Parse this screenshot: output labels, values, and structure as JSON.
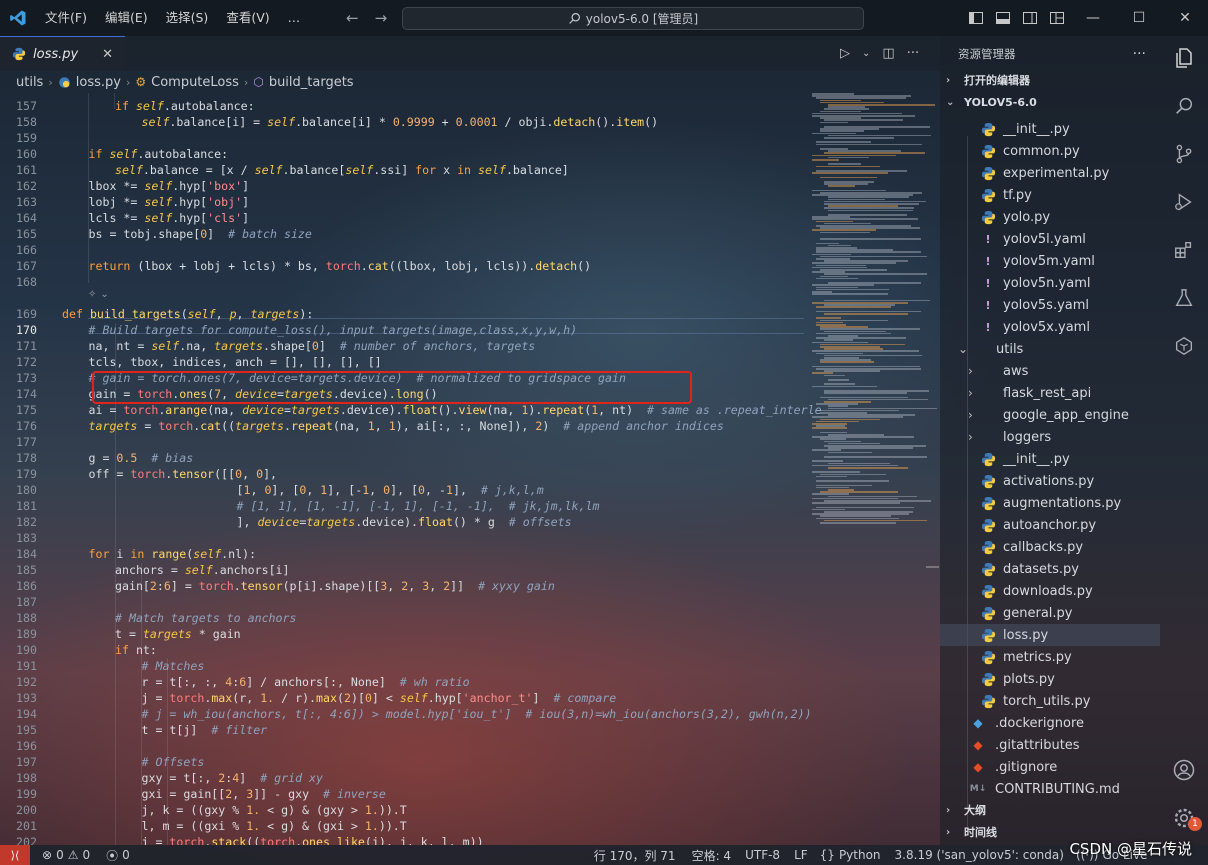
{
  "titlebar": {
    "menu": [
      "文件(F)",
      "编辑(E)",
      "选择(S)",
      "查看(V)",
      "…"
    ],
    "search": "yolov5-6.0 [管理员]"
  },
  "tab": {
    "name": "loss.py",
    "close": "✕"
  },
  "breadcrumb": {
    "folder": "utils",
    "file": "loss.py",
    "class": "ComputeLoss",
    "method": "build_targets"
  },
  "editor": {
    "active_line": 170,
    "lines": [
      {
        "n": "157",
        "indent": 2,
        "html": "<span class='kw'>if</span> <span class='self'>self</span>.autobalance:"
      },
      {
        "n": "158",
        "indent": 3,
        "html": "<span class='self'>self</span>.balance[i] = <span class='self'>self</span>.balance[i] * <span class='num'>0.9999</span> + <span class='num'>0.0001</span> / obji.<span class='fn'>detach</span>().<span class='fn'>item</span>()"
      },
      {
        "n": "159",
        "indent": 0,
        "html": ""
      },
      {
        "n": "160",
        "indent": 1,
        "html": "<span class='kw'>if</span> <span class='self'>self</span>.autobalance:"
      },
      {
        "n": "161",
        "indent": 2,
        "html": "<span class='self'>self</span>.balance = [x / <span class='self'>self</span>.balance[<span class='self'>self</span>.ssi] <span class='kw'>for</span> x <span class='kw'>in</span> <span class='self'>self</span>.balance]"
      },
      {
        "n": "162",
        "indent": 1,
        "html": "lbox *= <span class='self'>self</span>.hyp[<span class='str'>'box'</span>]"
      },
      {
        "n": "163",
        "indent": 1,
        "html": "lobj *= <span class='self'>self</span>.hyp[<span class='str'>'obj'</span>]"
      },
      {
        "n": "164",
        "indent": 1,
        "html": "lcls *= <span class='self'>self</span>.hyp[<span class='str'>'cls'</span>]"
      },
      {
        "n": "165",
        "indent": 1,
        "html": "bs = tobj.shape[<span class='num'>0</span>]  <span class='cm'># batch size</span>"
      },
      {
        "n": "166",
        "indent": 0,
        "html": ""
      },
      {
        "n": "167",
        "indent": 1,
        "html": "<span class='kw'>return</span> (lbox + lobj + lcls) * bs, <span class='mod'>torch</span>.<span class='fn'>cat</span>((lbox, lobj, lcls)).<span class='fn'>detach</span>()"
      },
      {
        "n": "168",
        "indent": 0,
        "html": ""
      },
      {
        "n": "",
        "indent": 0,
        "html": ""
      },
      {
        "n": "169",
        "indent": 0,
        "html": "<span class='kw'>def</span> <span class='fn'>build_targets</span>(<span class='param'>self</span>, <span class='param'>p</span>, <span class='param'>targets</span>):"
      },
      {
        "n": "170",
        "indent": 1,
        "html": "<span class='cm'># Build targets for compute_loss(), input targets(image,class,x,y,w,h)</span>"
      },
      {
        "n": "171",
        "indent": 1,
        "html": "na, nt = <span class='self'>self</span>.na, <span class='param'>targets</span>.shape[<span class='num'>0</span>]  <span class='cm'># number of anchors, targets</span>"
      },
      {
        "n": "172",
        "indent": 1,
        "html": "tcls, tbox, indices, anch = [], [], [], []"
      },
      {
        "n": "173",
        "indent": 1,
        "html": "<span class='cm'># gain = torch.ones(7, device=targets.device)  # normalized to gridspace gain</span>"
      },
      {
        "n": "174",
        "indent": 1,
        "html": "gain = <span class='mod'>torch</span>.<span class='fn'>ones</span>(<span class='num'>7</span>, <span class='kwarg'>device</span>=<span class='param'>targets</span>.device).<span class='fn'>long</span>()"
      },
      {
        "n": "175",
        "indent": 1,
        "html": "ai = <span class='mod'>torch</span>.<span class='fn'>arange</span>(na, <span class='kwarg'>device</span>=<span class='param'>targets</span>.device).<span class='fn'>float</span>().<span class='fn'>view</span>(na, <span class='num'>1</span>).<span class='fn'>repeat</span>(<span class='num'>1</span>, nt)  <span class='cm'># same as .repeat_interle</span>"
      },
      {
        "n": "176",
        "indent": 1,
        "html": "<span class='param'>targets</span> = <span class='mod'>torch</span>.<span class='fn'>cat</span>((<span class='param'>targets</span>.<span class='fn'>repeat</span>(na, <span class='num'>1</span>, <span class='num'>1</span>), ai[:, :, None]), <span class='num'>2</span>)  <span class='cm'># append anchor indices</span>"
      },
      {
        "n": "177",
        "indent": 0,
        "html": ""
      },
      {
        "n": "178",
        "indent": 1,
        "html": "g = <span class='num'>0.5</span>  <span class='cm'># bias</span>"
      },
      {
        "n": "179",
        "indent": 1,
        "html": "off = <span class='mod'>torch</span>.<span class='fn'>tensor</span>([[<span class='num'>0</span>, <span class='num'>0</span>],"
      },
      {
        "n": "180",
        "indent": 0,
        "html": "                         [<span class='num'>1</span>, <span class='num'>0</span>], [<span class='num'>0</span>, <span class='num'>1</span>], [-<span class='num'>1</span>, <span class='num'>0</span>], [<span class='num'>0</span>, -<span class='num'>1</span>],  <span class='cm'># j,k,l,m</span>"
      },
      {
        "n": "181",
        "indent": 0,
        "html": "                         <span class='cm'># [1, 1], [1, -1], [-1, 1], [-1, -1],  # jk,jm,lk,lm</span>"
      },
      {
        "n": "182",
        "indent": 0,
        "html": "                         ], <span class='kwarg'>device</span>=<span class='param'>targets</span>.device).<span class='fn'>float</span>() * g  <span class='cm'># offsets</span>"
      },
      {
        "n": "183",
        "indent": 0,
        "html": ""
      },
      {
        "n": "184",
        "indent": 1,
        "html": "<span class='kw'>for</span> i <span class='kw'>in</span> <span class='fn'>range</span>(<span class='self'>self</span>.nl):"
      },
      {
        "n": "185",
        "indent": 2,
        "html": "anchors = <span class='self'>self</span>.anchors[i]"
      },
      {
        "n": "186",
        "indent": 2,
        "html": "gain[<span class='num'>2</span>:<span class='num'>6</span>] = <span class='mod'>torch</span>.<span class='fn'>tensor</span>(p[i].shape)[[<span class='num'>3</span>, <span class='num'>2</span>, <span class='num'>3</span>, <span class='num'>2</span>]]  <span class='cm'># xyxy gain</span>"
      },
      {
        "n": "187",
        "indent": 0,
        "html": ""
      },
      {
        "n": "188",
        "indent": 2,
        "html": "<span class='cm'># Match targets to anchors</span>"
      },
      {
        "n": "189",
        "indent": 2,
        "html": "t = <span class='param'>targets</span> * gain"
      },
      {
        "n": "190",
        "indent": 2,
        "html": "<span class='kw'>if</span> nt:"
      },
      {
        "n": "191",
        "indent": 3,
        "html": "<span class='cm'># Matches</span>"
      },
      {
        "n": "192",
        "indent": 3,
        "html": "r = t[:, :, <span class='num'>4</span>:<span class='num'>6</span>] / anchors[:, None]  <span class='cm'># wh ratio</span>"
      },
      {
        "n": "193",
        "indent": 3,
        "html": "j = <span class='mod'>torch</span>.<span class='fn'>max</span>(r, <span class='num'>1.</span> / r).<span class='fn'>max</span>(<span class='num'>2</span>)[<span class='num'>0</span>] &lt; <span class='self'>self</span>.hyp[<span class='str'>'anchor_t'</span>]  <span class='cm'># compare</span>"
      },
      {
        "n": "194",
        "indent": 3,
        "html": "<span class='cm'># j = wh_iou(anchors, t[:, 4:6]) &gt; model.hyp['iou_t']  # iou(3,n)=wh_iou(anchors(3,2), gwh(n,2))</span>"
      },
      {
        "n": "195",
        "indent": 3,
        "html": "t = t[j]  <span class='cm'># filter</span>"
      },
      {
        "n": "196",
        "indent": 0,
        "html": ""
      },
      {
        "n": "197",
        "indent": 3,
        "html": "<span class='cm'># Offsets</span>"
      },
      {
        "n": "198",
        "indent": 3,
        "html": "gxy = t[:, <span class='num'>2</span>:<span class='num'>4</span>]  <span class='cm'># grid xy</span>"
      },
      {
        "n": "199",
        "indent": 3,
        "html": "gxi = gain[[<span class='num'>2</span>, <span class='num'>3</span>]] - gxy  <span class='cm'># inverse</span>"
      },
      {
        "n": "200",
        "indent": 3,
        "html": "j, k = ((gxy % <span class='num'>1.</span> &lt; g) &amp; (gxy &gt; <span class='num'>1.</span>)).T"
      },
      {
        "n": "201",
        "indent": 3,
        "html": "l, m = ((gxi % <span class='num'>1.</span> &lt; g) &amp; (gxi &gt; <span class='num'>1.</span>)).T"
      },
      {
        "n": "202",
        "indent": 3,
        "html": "j = <span class='mod'>torch</span>.<span class='fn'>stack</span>((<span class='mod'>torch</span>.<span class='fn'>ones_like</span>(j), j, k, l, m))"
      }
    ]
  },
  "explorer": {
    "title": "资源管理器",
    "open_editors": "打开的编辑器",
    "root": "YOLOV5-6.0",
    "items": [
      {
        "label": "__init__.py",
        "type": "py",
        "depth": 2
      },
      {
        "label": "common.py",
        "type": "py",
        "depth": 2
      },
      {
        "label": "experimental.py",
        "type": "py",
        "depth": 2
      },
      {
        "label": "tf.py",
        "type": "py",
        "depth": 2
      },
      {
        "label": "yolo.py",
        "type": "py",
        "depth": 2
      },
      {
        "label": "yolov5l.yaml",
        "type": "yaml",
        "depth": 2
      },
      {
        "label": "yolov5m.yaml",
        "type": "yaml",
        "depth": 2
      },
      {
        "label": "yolov5n.yaml",
        "type": "yaml",
        "depth": 2
      },
      {
        "label": "yolov5s.yaml",
        "type": "yaml",
        "depth": 2
      },
      {
        "label": "yolov5x.yaml",
        "type": "yaml",
        "depth": 2
      },
      {
        "label": "utils",
        "type": "folder-open",
        "depth": 1
      },
      {
        "label": "aws",
        "type": "folder",
        "depth": 2
      },
      {
        "label": "flask_rest_api",
        "type": "folder",
        "depth": 2
      },
      {
        "label": "google_app_engine",
        "type": "folder",
        "depth": 2
      },
      {
        "label": "loggers",
        "type": "folder",
        "depth": 2
      },
      {
        "label": "__init__.py",
        "type": "py",
        "depth": 2
      },
      {
        "label": "activations.py",
        "type": "py",
        "depth": 2
      },
      {
        "label": "augmentations.py",
        "type": "py",
        "depth": 2
      },
      {
        "label": "autoanchor.py",
        "type": "py",
        "depth": 2
      },
      {
        "label": "callbacks.py",
        "type": "py",
        "depth": 2
      },
      {
        "label": "datasets.py",
        "type": "py",
        "depth": 2
      },
      {
        "label": "downloads.py",
        "type": "py",
        "depth": 2
      },
      {
        "label": "general.py",
        "type": "py",
        "depth": 2
      },
      {
        "label": "loss.py",
        "type": "py",
        "depth": 2,
        "selected": true
      },
      {
        "label": "metrics.py",
        "type": "py",
        "depth": 2
      },
      {
        "label": "plots.py",
        "type": "py",
        "depth": 2
      },
      {
        "label": "torch_utils.py",
        "type": "py",
        "depth": 2
      },
      {
        "label": ".dockerignore",
        "type": "docker",
        "depth": 1
      },
      {
        "label": ".gitattributes",
        "type": "git",
        "depth": 1
      },
      {
        "label": ".gitignore",
        "type": "git",
        "depth": 1
      },
      {
        "label": "CONTRIBUTING.md",
        "type": "md",
        "depth": 1
      }
    ],
    "outline": "大纲",
    "timeline": "时间线"
  },
  "activity": {
    "badge": "1"
  },
  "statusbar": {
    "errors": "0",
    "warnings": "0",
    "ports": "0",
    "position": "行 170，列 71",
    "spaces": "空格: 4",
    "encoding": "UTF-8",
    "eol": "LF",
    "language": "Python",
    "interpreter": "3.8.19 ('san_yolov5': conda)",
    "golive": "Go Live"
  },
  "watermark": "CSDN @星石传说",
  "colors": {
    "accent": "#3b6fd1",
    "highlight_box": "#e0231b",
    "remote": "#c0392b"
  }
}
